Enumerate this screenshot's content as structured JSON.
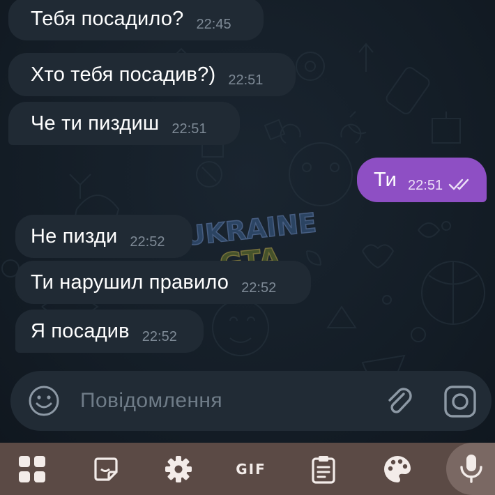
{
  "chat": {
    "messages": [
      {
        "direction": "in",
        "text": "Тебя посадило?",
        "time": "22:45"
      },
      {
        "direction": "in",
        "text": "Хто тебя посадив?)",
        "time": "22:51"
      },
      {
        "direction": "in",
        "text": "Че ти пиздиш",
        "time": "22:51"
      },
      {
        "direction": "out",
        "text": "Ти",
        "time": "22:51",
        "status": "read-double-check"
      },
      {
        "direction": "in",
        "text": "Не пизди",
        "time": "22:52"
      },
      {
        "direction": "in",
        "text": "Ти нарушил правило",
        "time": "22:52"
      },
      {
        "direction": "in",
        "text": "Я посадив",
        "time": "22:52"
      }
    ],
    "watermark": {
      "line1": "UKRAINE",
      "line2": "GTA"
    }
  },
  "composer": {
    "placeholder": "Повідомлення",
    "icons": [
      "emoji-icon",
      "paperclip-icon",
      "camera-icon"
    ]
  },
  "keyboard_toolbar": {
    "gif_label": "GIF",
    "icons": [
      "apps-grid-icon",
      "sticker-icon",
      "settings-gear-icon",
      "gif-icon",
      "clipboard-icon",
      "palette-icon",
      "microphone-icon"
    ]
  },
  "colors": {
    "incoming_bubble": "#202a34",
    "outgoing_bubble": "#8e4fc4",
    "background": "#131c25",
    "keyboard_bar": "#5b4a45"
  }
}
